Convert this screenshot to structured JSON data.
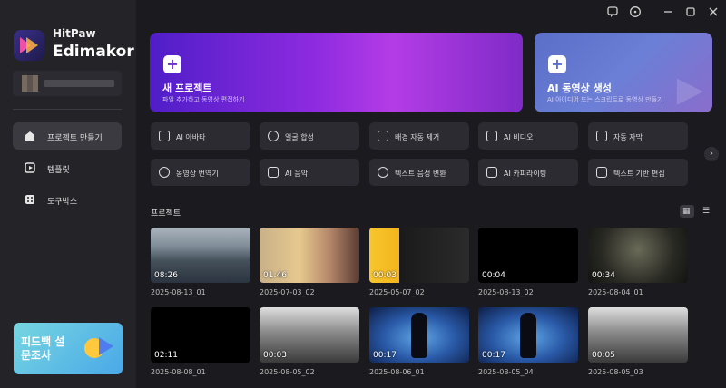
{
  "app": {
    "brand_top": "HitPaw",
    "brand_main": "Edimakor"
  },
  "sidebar": {
    "items": [
      {
        "label": "프로젝트 만들기",
        "icon": "home-icon"
      },
      {
        "label": "템플릿",
        "icon": "template-icon"
      },
      {
        "label": "도구박스",
        "icon": "toolbox-icon"
      }
    ],
    "promo": {
      "text": "피드백 설문조사"
    }
  },
  "titlebar": {
    "icons": [
      "feedback-icon",
      "help-icon",
      "minimize-icon",
      "maximize-icon",
      "close-icon"
    ]
  },
  "hero": {
    "new_project": {
      "title": "새 프로젝트",
      "subtitle": "파일 추가하고 동영상 편집하기"
    },
    "ai_video": {
      "title": "AI 동영상 생성",
      "subtitle": "AI 아이디어 또는 스크립트로 동영상 만들기"
    }
  },
  "tools": [
    {
      "label": "AI 아바타",
      "icon": "avatar-icon"
    },
    {
      "label": "얼굴 합성",
      "icon": "face-swap-icon"
    },
    {
      "label": "배경 자동 제거",
      "icon": "background-remove-icon"
    },
    {
      "label": "AI 비디오",
      "icon": "ai-video-icon"
    },
    {
      "label": "자동 자막",
      "icon": "subtitle-icon"
    },
    {
      "label": "동영상 번역기",
      "icon": "translate-icon"
    },
    {
      "label": "AI 음악",
      "icon": "music-icon"
    },
    {
      "label": "텍스트 음성 변환",
      "icon": "text-to-speech-icon"
    },
    {
      "label": "AI 카피라이팅",
      "icon": "copywriting-icon"
    },
    {
      "label": "텍스트 기반 편집",
      "icon": "text-edit-icon"
    }
  ],
  "projects": {
    "heading": "프로젝트",
    "items": [
      {
        "duration": "08:26",
        "name": "2025-08-13_01"
      },
      {
        "duration": "01:46",
        "name": "2025-07-03_02"
      },
      {
        "duration": "00:03",
        "name": "2025-05-07_02"
      },
      {
        "duration": "00:04",
        "name": "2025-08-13_02"
      },
      {
        "duration": "00:34",
        "name": "2025-08-04_01"
      },
      {
        "duration": "02:11",
        "name": "2025-08-08_01"
      },
      {
        "duration": "00:03",
        "name": "2025-08-05_02"
      },
      {
        "duration": "00:17",
        "name": "2025-08-06_01"
      },
      {
        "duration": "00:17",
        "name": "2025-08-05_04"
      },
      {
        "duration": "00:05",
        "name": "2025-08-05_03"
      }
    ]
  }
}
